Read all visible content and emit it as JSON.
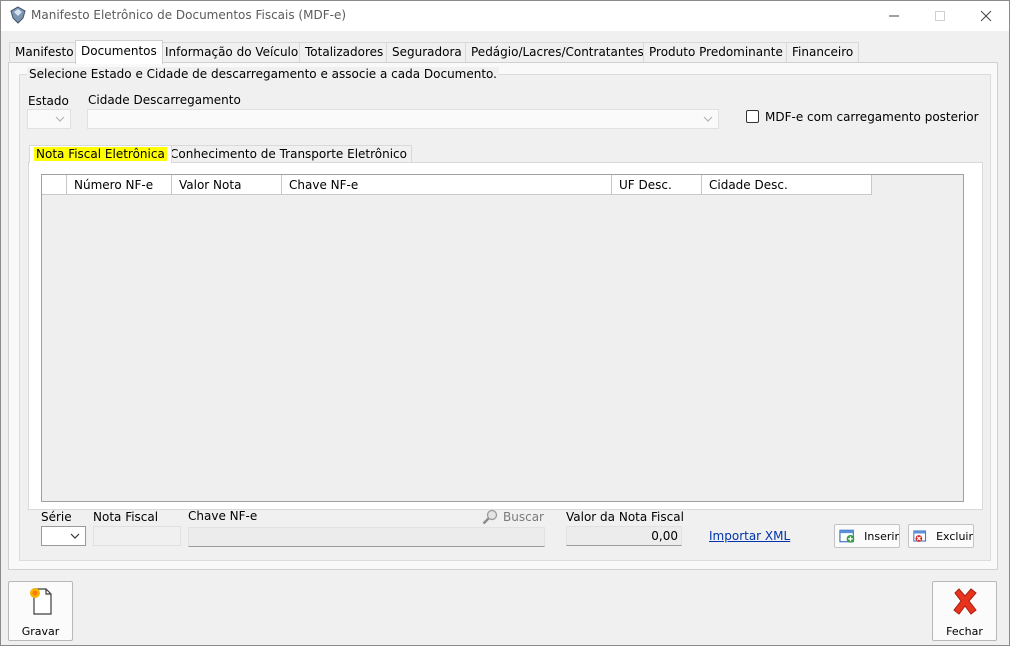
{
  "window": {
    "title": "Manifesto Eletrônico de Documentos Fiscais (MDF-e)"
  },
  "tabs": [
    {
      "label": "Manifesto"
    },
    {
      "label": "Documentos"
    },
    {
      "label": "Informação do Veículo"
    },
    {
      "label": "Totalizadores"
    },
    {
      "label": "Seguradora"
    },
    {
      "label": "Pedágio/Lacres/Contratantes"
    },
    {
      "label": "Produto Predominante"
    },
    {
      "label": "Financeiro"
    }
  ],
  "documentos": {
    "group_caption": "Selecione Estado e Cidade de descarregamento e associe a cada Documento.",
    "estado_label": "Estado",
    "estado_value": "",
    "cidade_label": "Cidade Descarregamento",
    "cidade_value": "",
    "checkbox_label": "MDF-e com carregamento posterior",
    "checkbox_checked": false,
    "subtabs": [
      {
        "label": "Nota Fiscal Eletrônica"
      },
      {
        "label": "Conhecimento de Transporte Eletrônico"
      }
    ],
    "grid": {
      "columns": [
        "",
        "Número NF-e",
        "Valor Nota",
        "Chave NF-e",
        "UF Desc.",
        "Cidade Desc."
      ],
      "rows": []
    },
    "serie_label": "Série",
    "serie_value": "",
    "nota_fiscal_label": "Nota Fiscal",
    "nota_fiscal_value": "",
    "chave_label": "Chave NF-e",
    "chave_value": "",
    "buscar_label": "Buscar",
    "valor_label": "Valor da Nota Fiscal",
    "valor_value": "0,00",
    "importar_label": "Importar XML",
    "inserir_label": "Inserir",
    "excluir_label": "Excluir"
  },
  "footer": {
    "gravar_label": "Gravar",
    "fechar_label": "Fechar"
  },
  "colors": {
    "highlight": "#ffff00",
    "link": "#0033aa",
    "fechar_icon": "#e8341c"
  }
}
